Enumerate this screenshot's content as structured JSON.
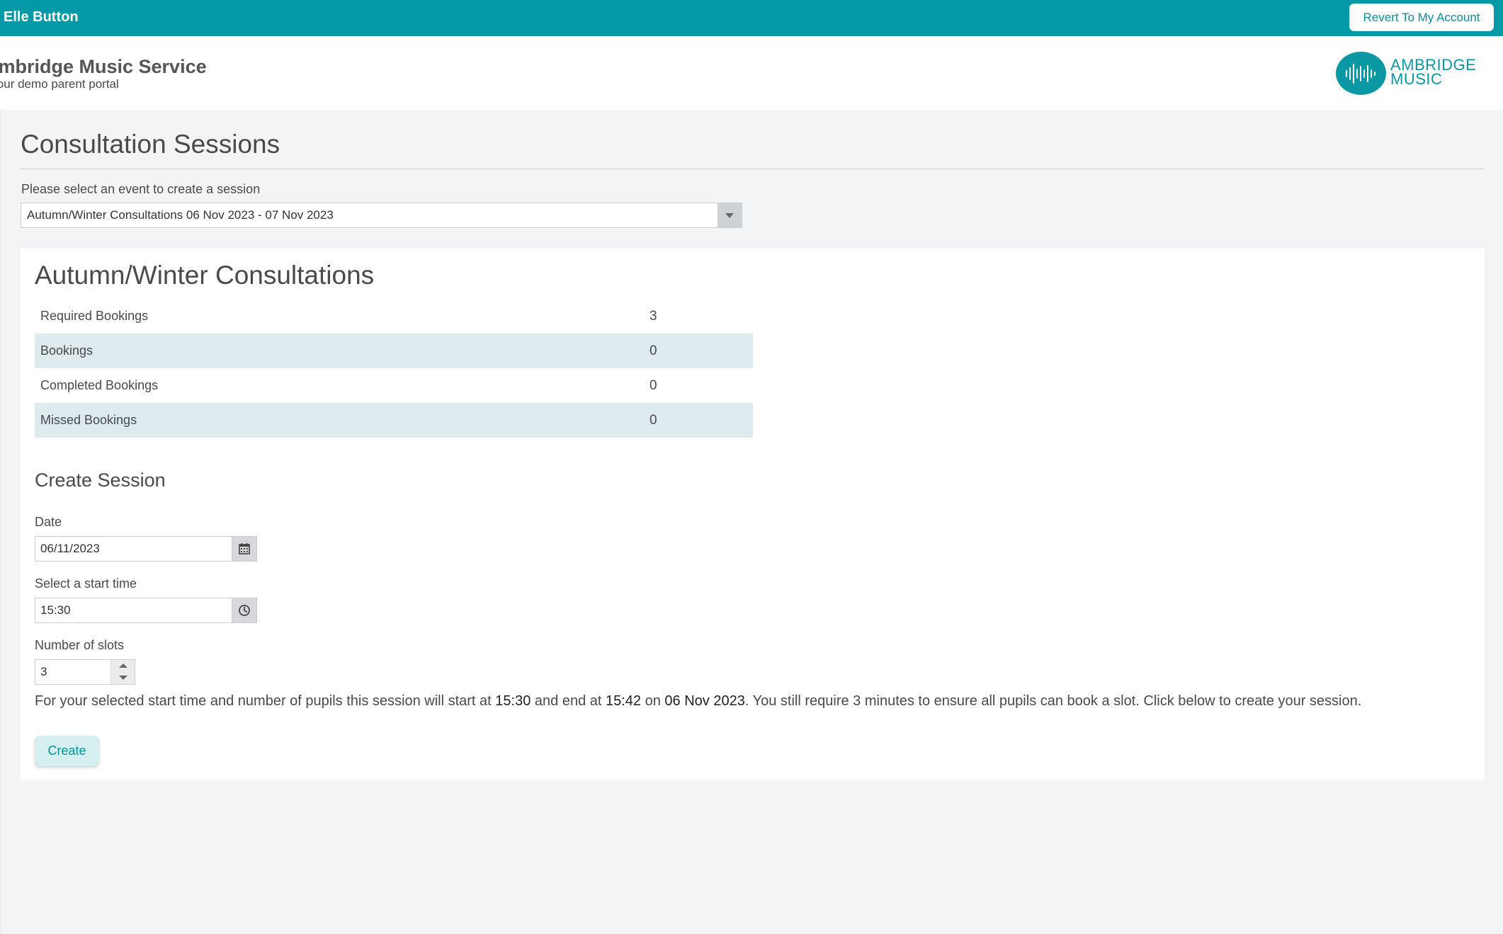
{
  "topbar": {
    "user_name": "Elle Button",
    "revert_label": "Revert To My Account"
  },
  "header": {
    "site_name": "Ambridge Music Service",
    "site_subtitle": "Your demo parent portal",
    "logo_line1": "AMBRIDGE",
    "logo_line2": "MUSIC"
  },
  "page": {
    "title": "Consultation Sessions",
    "event_label": "Please select an event to create a session",
    "event_selected": "Autumn/Winter Consultations 06 Nov 2023 - 07 Nov 2023"
  },
  "event": {
    "title": "Autumn/Winter Consultations",
    "stats": [
      {
        "label": "Required Bookings",
        "value": "3"
      },
      {
        "label": "Bookings",
        "value": "0"
      },
      {
        "label": "Completed Bookings",
        "value": "0"
      },
      {
        "label": "Missed Bookings",
        "value": "0"
      }
    ]
  },
  "create_session": {
    "title": "Create Session",
    "date_label": "Date",
    "date_value": "06/11/2023",
    "start_label": "Select a start time",
    "start_value": "15:30",
    "slots_label": "Number of slots",
    "slots_value": "3",
    "summary": {
      "part1": "For your selected start time and number of pupils this session will start at ",
      "start": "15:30",
      "part2": " and end at ",
      "end": "15:42",
      "part3": " on ",
      "date": "06 Nov 2023",
      "part4": ". You still require 3 minutes to ensure all pupils can book a slot. Click below to create your session."
    },
    "create_label": "Create"
  },
  "colors": {
    "brand_teal": "#0399a6",
    "row_shade": "#ddebef",
    "page_bg": "#f3f4f6"
  },
  "icons": {
    "date_addon": "calendar-icon",
    "time_addon": "clock-icon",
    "select_caret": "caret-down-icon",
    "logo": "soundwave-icon"
  }
}
